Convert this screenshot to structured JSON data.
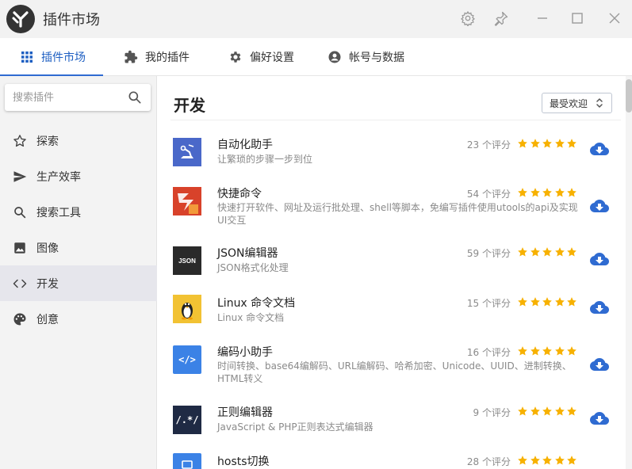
{
  "app": {
    "title": "插件市场"
  },
  "tabs": [
    {
      "label": "插件市场",
      "icon": "grid-icon"
    },
    {
      "label": "我的插件",
      "icon": "puzzle-icon"
    },
    {
      "label": "偏好设置",
      "icon": "gear-icon"
    },
    {
      "label": "帐号与数据",
      "icon": "account-icon"
    }
  ],
  "sidebar": {
    "search_placeholder": "搜索插件",
    "items": [
      {
        "label": "探索",
        "icon": "star-outline-icon"
      },
      {
        "label": "生产效率",
        "icon": "send-icon"
      },
      {
        "label": "搜索工具",
        "icon": "magnifier-icon"
      },
      {
        "label": "图像",
        "icon": "image-icon"
      },
      {
        "label": "开发",
        "icon": "code-icon"
      },
      {
        "label": "创意",
        "icon": "palette-icon"
      }
    ]
  },
  "main": {
    "section_title": "开发",
    "sort_label": "最受欢迎",
    "plugins": [
      {
        "name": "自动化助手",
        "desc": "让繁琐的步骤一步到位",
        "rating": "23 个评分",
        "stars": 5,
        "icon_color": "#4a68c9"
      },
      {
        "name": "快捷命令",
        "desc": "快速打开软件、网址及运行批处理、shell等脚本，免编写插件使用utools的api及实现UI交互",
        "rating": "54 个评分",
        "stars": 5,
        "icon_color": "#d8422a"
      },
      {
        "name": "JSON编辑器",
        "desc": "JSON格式化处理",
        "rating": "59 个评分",
        "stars": 5,
        "icon_color": "#2a2a2a",
        "icon_text": "JSON"
      },
      {
        "name": "Linux 命令文档",
        "desc": "Linux 命令文档",
        "rating": "15 个评分",
        "stars": 5,
        "icon_color": "#f2c233"
      },
      {
        "name": "编码小助手",
        "desc": "时间转换、base64编解码、URL编解码、哈希加密、Unicode、UUID、进制转换、HTML转义",
        "rating": "16 个评分",
        "stars": 5,
        "icon_color": "#3b82e6",
        "icon_text": "</>"
      },
      {
        "name": "正则编辑器",
        "desc": "JavaScript & PHP正则表达式编辑器",
        "rating": "9 个评分",
        "stars": 5,
        "icon_color": "#1f2a44",
        "icon_text": "/.*/"
      },
      {
        "name": "hosts切换",
        "desc": "",
        "rating": "28 个评分",
        "stars": 5,
        "icon_color": "#3b82e6"
      }
    ]
  }
}
